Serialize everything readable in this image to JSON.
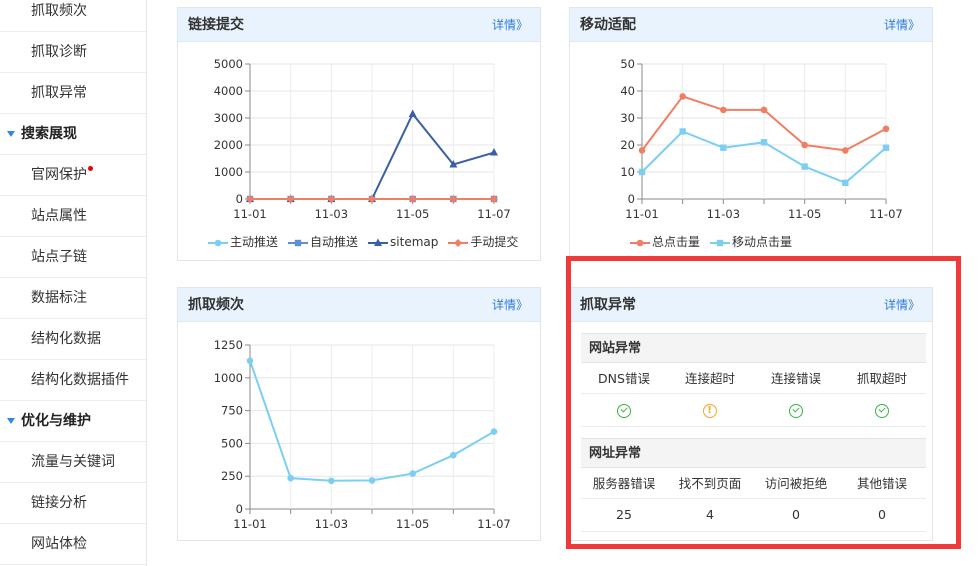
{
  "sidebar": {
    "items": [
      {
        "label": "抓取频次",
        "type": "sub"
      },
      {
        "label": "抓取诊断",
        "type": "sub"
      },
      {
        "label": "抓取异常",
        "type": "sub"
      },
      {
        "label": "搜索展现",
        "type": "group"
      },
      {
        "label": "官网保护",
        "type": "sub",
        "badge": true
      },
      {
        "label": "站点属性",
        "type": "sub"
      },
      {
        "label": "站点子链",
        "type": "sub"
      },
      {
        "label": "数据标注",
        "type": "sub"
      },
      {
        "label": "结构化数据",
        "type": "sub"
      },
      {
        "label": "结构化数据插件",
        "type": "sub"
      },
      {
        "label": "优化与维护",
        "type": "group"
      },
      {
        "label": "流量与关键词",
        "type": "sub"
      },
      {
        "label": "链接分析",
        "type": "sub"
      },
      {
        "label": "网站体检",
        "type": "sub"
      }
    ]
  },
  "panels": {
    "link_submit": {
      "title": "链接提交",
      "more": "详情》"
    },
    "mobile": {
      "title": "移动适配",
      "more": "详情》"
    },
    "crawl_freq": {
      "title": "抓取频次",
      "more": "详情》"
    },
    "crawl_error": {
      "title": "抓取异常",
      "more": "详情》",
      "site_section": "网站异常",
      "site_headers": [
        "DNS错误",
        "连接超时",
        "连接错误",
        "抓取超时"
      ],
      "site_status": [
        "ok",
        "warn",
        "ok",
        "ok"
      ],
      "url_section": "网址异常",
      "url_headers": [
        "服务器错误",
        "找不到页面",
        "访问被拒绝",
        "其他错误"
      ],
      "url_values": [
        "25",
        "4",
        "0",
        "0"
      ]
    }
  },
  "colors": {
    "accent": "#2f7bd8",
    "highlight": "#f03a3a",
    "ok": "#3bb34a",
    "warn": "#f5a623"
  },
  "chart_data": [
    {
      "type": "line",
      "x": [
        "11-01",
        "11-02",
        "11-03",
        "11-04",
        "11-05",
        "11-06",
        "11-07"
      ],
      "x_tick_labels": [
        "11-01",
        "11-03",
        "11-05",
        "11-07"
      ],
      "ylim": [
        0,
        5000
      ],
      "y_ticks": [
        "0",
        "1000",
        "2000",
        "3000",
        "4000",
        "5000"
      ],
      "grid": true,
      "legend_position": "bottom",
      "series": [
        {
          "name": "主动推送",
          "color": "#7ccff2",
          "marker": "circle",
          "values": [
            0,
            0,
            0,
            0,
            0,
            0,
            0
          ]
        },
        {
          "name": "自动推送",
          "color": "#5b8fd8",
          "marker": "square",
          "values": [
            0,
            0,
            0,
            0,
            0,
            0,
            0
          ]
        },
        {
          "name": "sitemap",
          "color": "#3a5fa6",
          "marker": "triangle",
          "values": [
            0,
            0,
            0,
            0,
            3150,
            1280,
            1720
          ]
        },
        {
          "name": "手动提交",
          "color": "#f17e63",
          "marker": "diamond",
          "values": [
            0,
            0,
            0,
            0,
            0,
            0,
            0
          ]
        }
      ]
    },
    {
      "type": "line",
      "x": [
        "11-01",
        "11-02",
        "11-03",
        "11-04",
        "11-05",
        "11-06",
        "11-07"
      ],
      "x_tick_labels": [
        "11-01",
        "11-03",
        "11-05",
        "11-07"
      ],
      "ylim": [
        0,
        50
      ],
      "y_ticks": [
        "0",
        "10",
        "20",
        "30",
        "40",
        "50"
      ],
      "grid": true,
      "legend_position": "bottom",
      "series": [
        {
          "name": "总点击量",
          "color": "#f17e63",
          "marker": "circle",
          "values": [
            18,
            38,
            33,
            33,
            20,
            18,
            26
          ]
        },
        {
          "name": "移动点击量",
          "color": "#7ccff2",
          "marker": "square",
          "values": [
            10,
            25,
            19,
            21,
            12,
            6,
            19
          ]
        }
      ]
    },
    {
      "type": "line",
      "x": [
        "11-01",
        "11-02",
        "11-03",
        "11-04",
        "11-05",
        "11-06",
        "11-07"
      ],
      "x_tick_labels": [
        "11-01",
        "11-03",
        "11-05",
        "11-07"
      ],
      "ylim": [
        0,
        1250
      ],
      "y_ticks": [
        "0",
        "250",
        "500",
        "750",
        "1000",
        "1250"
      ],
      "grid": true,
      "series": [
        {
          "color": "#7ccff2",
          "marker": "circle",
          "values": [
            1130,
            235,
            215,
            218,
            270,
            410,
            590
          ]
        }
      ]
    }
  ]
}
